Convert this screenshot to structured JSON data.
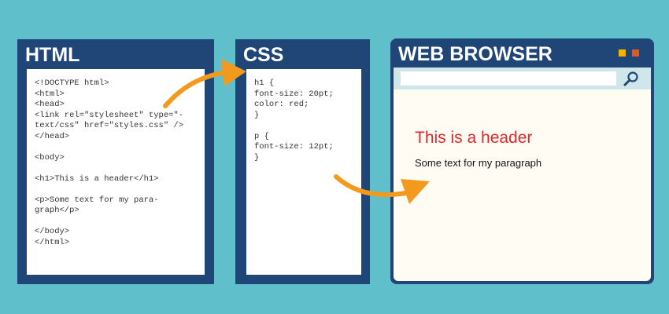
{
  "html_panel": {
    "title": "HTML",
    "code_lines": [
      "<!DOCTYPE html>",
      "<html>",
      "<head>",
      "<link rel=\"stylesheet\" type=\"-",
      "text/css\" href=\"styles.css\" />",
      "</head>",
      "",
      "<body>",
      "",
      "<h1>This is a header</h1>",
      "",
      "<p>Some text for my para-",
      "graph</p>",
      "",
      "</body>",
      "</html>"
    ]
  },
  "css_panel": {
    "title": "CSS",
    "code_lines": [
      "h1 {",
      "font-size: 20pt;",
      "color: red;",
      "}",
      "",
      "p {",
      "font-size: 12pt;",
      "}"
    ]
  },
  "browser": {
    "title": "WEB BROWSER",
    "address_value": "",
    "header_text": "This is a header",
    "paragraph_text": "Some text for my paragraph",
    "icons": {
      "search": "magnifier-icon",
      "window_buttons": [
        "yellow-square-icon",
        "orange-square-icon"
      ]
    }
  },
  "colors": {
    "background": "#5fbfca",
    "panel": "#1f4677",
    "arrow": "#f39a1e",
    "header_red": "#e4262b",
    "browser_page": "#fffdf3",
    "address_bar": "#cfe6ea"
  },
  "arrows": [
    {
      "from": "html_panel",
      "to": "css_panel"
    },
    {
      "from": "css_panel",
      "to": "browser"
    }
  ]
}
